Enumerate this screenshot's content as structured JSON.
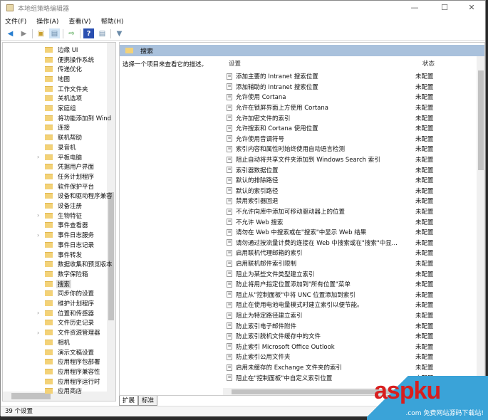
{
  "window": {
    "title": "本地组策略编辑器",
    "minimize": "—",
    "maximize": "☐",
    "close": "✕"
  },
  "menu": [
    "文件(F)",
    "操作(A)",
    "查看(V)",
    "帮助(H)"
  ],
  "tree": {
    "items": [
      {
        "label": "边缘 UI",
        "arrow": false
      },
      {
        "label": "便携操作系统",
        "arrow": false
      },
      {
        "label": "传递优化",
        "arrow": false
      },
      {
        "label": "地图",
        "arrow": false
      },
      {
        "label": "工作文件夹",
        "arrow": false
      },
      {
        "label": "关机选项",
        "arrow": false
      },
      {
        "label": "家庭组",
        "arrow": false
      },
      {
        "label": "将功能添加到 Wind",
        "arrow": false
      },
      {
        "label": "连接",
        "arrow": false
      },
      {
        "label": "联机帮助",
        "arrow": false
      },
      {
        "label": "录音机",
        "arrow": false
      },
      {
        "label": "平板电脑",
        "arrow": true
      },
      {
        "label": "凭据用户界面",
        "arrow": false
      },
      {
        "label": "任务计划程序",
        "arrow": false
      },
      {
        "label": "软件保护平台",
        "arrow": false
      },
      {
        "label": "设备和驱动程序兼容",
        "arrow": false
      },
      {
        "label": "设备注册",
        "arrow": false
      },
      {
        "label": "生物特征",
        "arrow": true
      },
      {
        "label": "事件查看器",
        "arrow": false
      },
      {
        "label": "事件日志服务",
        "arrow": true
      },
      {
        "label": "事件日志记录",
        "arrow": false
      },
      {
        "label": "事件转发",
        "arrow": false
      },
      {
        "label": "数据收集和预览版本",
        "arrow": false
      },
      {
        "label": "数字保险箱",
        "arrow": false
      },
      {
        "label": "搜索",
        "arrow": false,
        "selected": true
      },
      {
        "label": "同步你的设置",
        "arrow": false
      },
      {
        "label": "维护计划程序",
        "arrow": false
      },
      {
        "label": "位置和传感器",
        "arrow": true
      },
      {
        "label": "文件历史记录",
        "arrow": false
      },
      {
        "label": "文件资源管理器",
        "arrow": true
      },
      {
        "label": "相机",
        "arrow": false
      },
      {
        "label": "演示文稿设置",
        "arrow": false
      },
      {
        "label": "应用程序包部署",
        "arrow": false
      },
      {
        "label": "应用程序兼容性",
        "arrow": false
      },
      {
        "label": "应用程序运行时",
        "arrow": false
      },
      {
        "label": "应用商店",
        "arrow": false
      }
    ]
  },
  "main": {
    "header": "搜索",
    "description": "选择一个项目来查看它的描述。",
    "col_setting": "设置",
    "col_state": "状态",
    "rows": [
      {
        "name": "添加主要的 Intranet 搜索位置",
        "state": "未配置"
      },
      {
        "name": "添加辅助的 Intranet 搜索位置",
        "state": "未配置"
      },
      {
        "name": "允许使用 Cortana",
        "state": "未配置"
      },
      {
        "name": "允许在锁屏界面上方使用 Cortana",
        "state": "未配置"
      },
      {
        "name": "允许加密文件的索引",
        "state": "未配置"
      },
      {
        "name": "允许搜索和 Cortana 使用位置",
        "state": "未配置"
      },
      {
        "name": "允许使用音调符号",
        "state": "未配置"
      },
      {
        "name": "索引内容和属性时始终使用自动语言检测",
        "state": "未配置"
      },
      {
        "name": "阻止自动将共享文件夹添加到 Windows Search 索引",
        "state": "未配置"
      },
      {
        "name": "索引器数据位置",
        "state": "未配置"
      },
      {
        "name": "默认的排除路径",
        "state": "未配置"
      },
      {
        "name": "默认的索引路径",
        "state": "未配置"
      },
      {
        "name": "禁用索引器回退",
        "state": "未配置"
      },
      {
        "name": "不允许向库中添加可移动驱动器上的位置",
        "state": "未配置"
      },
      {
        "name": "不允许 Web 搜索",
        "state": "未配置"
      },
      {
        "name": "请勿在 Web 中搜索或在\"搜索\"中显示 Web 结果",
        "state": "未配置"
      },
      {
        "name": "请勿通过按流量计费的连接在 Web 中搜索或在\"搜索\"中显...",
        "state": "未配置"
      },
      {
        "name": "启用联机代理邮箱的索引",
        "state": "未配置"
      },
      {
        "name": "启用联机邮件索引限制",
        "state": "未配置"
      },
      {
        "name": "阻止为某些文件类型建立索引",
        "state": "未配置"
      },
      {
        "name": "防止将用户指定位置添加到\"所有位置\"菜单",
        "state": "未配置"
      },
      {
        "name": "阻止从\"控制面板\"中将 UNC 位置添加到索引",
        "state": "未配置"
      },
      {
        "name": "阻止在使用电池电量模式时建立索引以便节能。",
        "state": "未配置"
      },
      {
        "name": "阻止为特定路径建立索引",
        "state": "未配置"
      },
      {
        "name": "防止索引电子邮件附件",
        "state": "未配置"
      },
      {
        "name": "防止索引脱机文件缓存中的文件",
        "state": "未配置"
      },
      {
        "name": "防止索引 Microsoft Office Outlook",
        "state": "未配置"
      },
      {
        "name": "防止索引公用文件夹",
        "state": "未配置"
      },
      {
        "name": "启用未缓存的 Exchange 文件夹的索引",
        "state": "未配置"
      },
      {
        "name": "阻止在\"控制面板\"中自定义索引位置",
        "state": "未配置"
      }
    ]
  },
  "tabs": [
    "扩展",
    "标准"
  ],
  "status": "39 个设置",
  "watermark": {
    "brand": "aspku",
    "domain": ".com",
    "tagline": "免费网站源码下载站!"
  }
}
